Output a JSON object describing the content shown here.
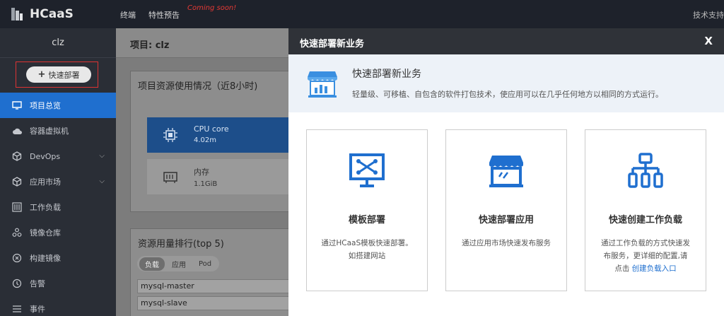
{
  "app": {
    "name": "HCaaS"
  },
  "topnav": {
    "items": [
      "终端",
      "特性预告"
    ],
    "coming_soon": "Coming soon!",
    "support": "技术支持"
  },
  "sidebar": {
    "project": "clz",
    "quick_deploy": "快速部署",
    "items": [
      {
        "label": "项目总览",
        "icon": "overview-icon",
        "active": true
      },
      {
        "label": "容器虚拟机",
        "icon": "cloud-icon"
      },
      {
        "label": "DevOps",
        "icon": "cube-icon",
        "expandable": true
      },
      {
        "label": "应用市场",
        "icon": "cube-icon",
        "expandable": true
      },
      {
        "label": "工作负载",
        "icon": "workload-icon"
      },
      {
        "label": "镜像仓库",
        "icon": "registry-icon"
      },
      {
        "label": "构建镜像",
        "icon": "build-icon"
      },
      {
        "label": "告警",
        "icon": "alarm-icon"
      },
      {
        "label": "事件",
        "icon": "list-icon"
      }
    ]
  },
  "main": {
    "breadcrumb": "项目: clz",
    "usage_card": {
      "title": "项目资源使用情况（近8小时)",
      "cpu": {
        "label": "CPU core",
        "value": "4.02m"
      },
      "memory": {
        "label": "内存",
        "value": "1.1GiB"
      }
    },
    "rank_card": {
      "title": "资源用量排行(top 5)",
      "tabs": [
        "负载",
        "应用",
        "Pod"
      ],
      "active_tab": "负载",
      "rows": [
        "mysql-master",
        "mysql-slave"
      ]
    }
  },
  "modal": {
    "title": "快速部署新业务",
    "close": "X",
    "intro_title": "快速部署新业务",
    "intro_desc": "轻量级、可移植、自包含的软件打包技术，使应用可以在几乎任何地方以相同的方式运行。",
    "options": [
      {
        "title": "模板部署",
        "desc1": "通过HCaaS模板快速部署。",
        "desc2": "如搭建网站",
        "icon": "template-icon"
      },
      {
        "title": "快速部署应用",
        "desc1": "通过应用市场快速发布服务",
        "icon": "store-icon"
      },
      {
        "title": "快速创建工作负载",
        "desc1": "通过工作负载的方式快速发",
        "desc2": "布服务，更详细的配置,请",
        "desc3": "点击",
        "link": "创建负载入口",
        "icon": "network-icon"
      }
    ]
  },
  "colors": {
    "accent": "#1f6fcf",
    "sidebar": "#2a2e36",
    "topbar": "#1e222b",
    "highlight": "#dd3333"
  }
}
